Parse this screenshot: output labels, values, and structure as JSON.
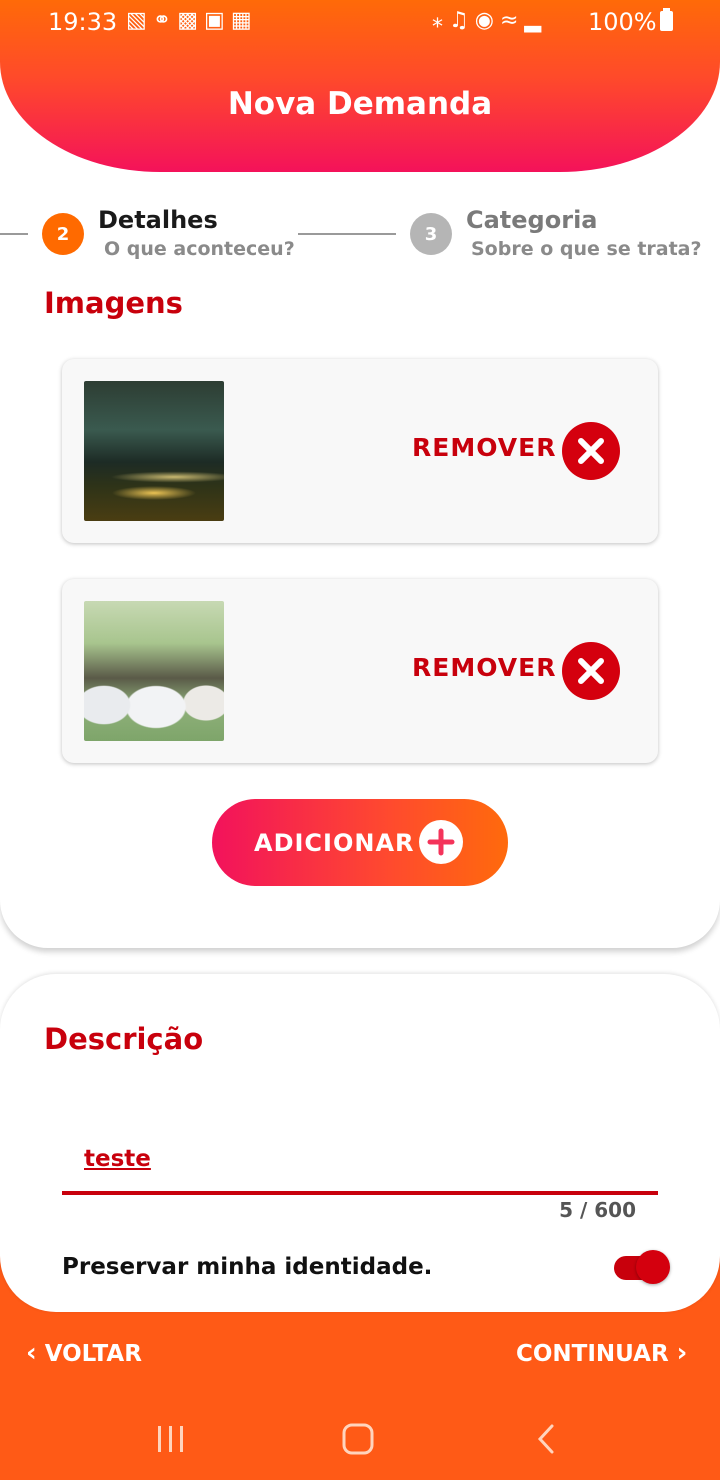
{
  "status_bar": {
    "time": "19:33",
    "battery": "100%",
    "left_icons": [
      "equalizer-icon",
      "link-icon",
      "sim-icon",
      "image-icon",
      "calendar-icon"
    ],
    "right_icons": [
      "bluetooth-icon",
      "mute-icon",
      "location-icon",
      "wifi-icon",
      "signal-icon",
      "battery-icon"
    ]
  },
  "header": {
    "title": "Nova Demanda"
  },
  "stepper": {
    "steps": [
      {
        "number": "2",
        "title": "Detalhes",
        "subtitle": "O que aconteceu?",
        "active": true
      },
      {
        "number": "3",
        "title": "Categoria",
        "subtitle": "Sobre o que se trata?",
        "active": false
      }
    ],
    "active_color": "#ff6a00",
    "inactive_color": "#b5b5b5"
  },
  "images_section": {
    "title": "Imagens",
    "items": [
      {
        "thumbnail": "city-night-highway-photo",
        "remove_label": "REMOVER"
      },
      {
        "thumbnail": "routers-on-table-photo",
        "remove_label": "REMOVER"
      }
    ],
    "add_label": "ADICIONAR"
  },
  "description": {
    "title": "Descrição",
    "value": "teste",
    "counter": "5 / 600"
  },
  "identity": {
    "label": "Preservar minha identidade.",
    "enabled": true
  },
  "navigation": {
    "back_label": "VOLTAR",
    "next_label": "CONTINUAR"
  },
  "colors": {
    "brand_red": "#c8000c",
    "brand_orange": "#ff6a00",
    "brand_pink": "#f2125c",
    "nav_background": "#ff5a16"
  }
}
